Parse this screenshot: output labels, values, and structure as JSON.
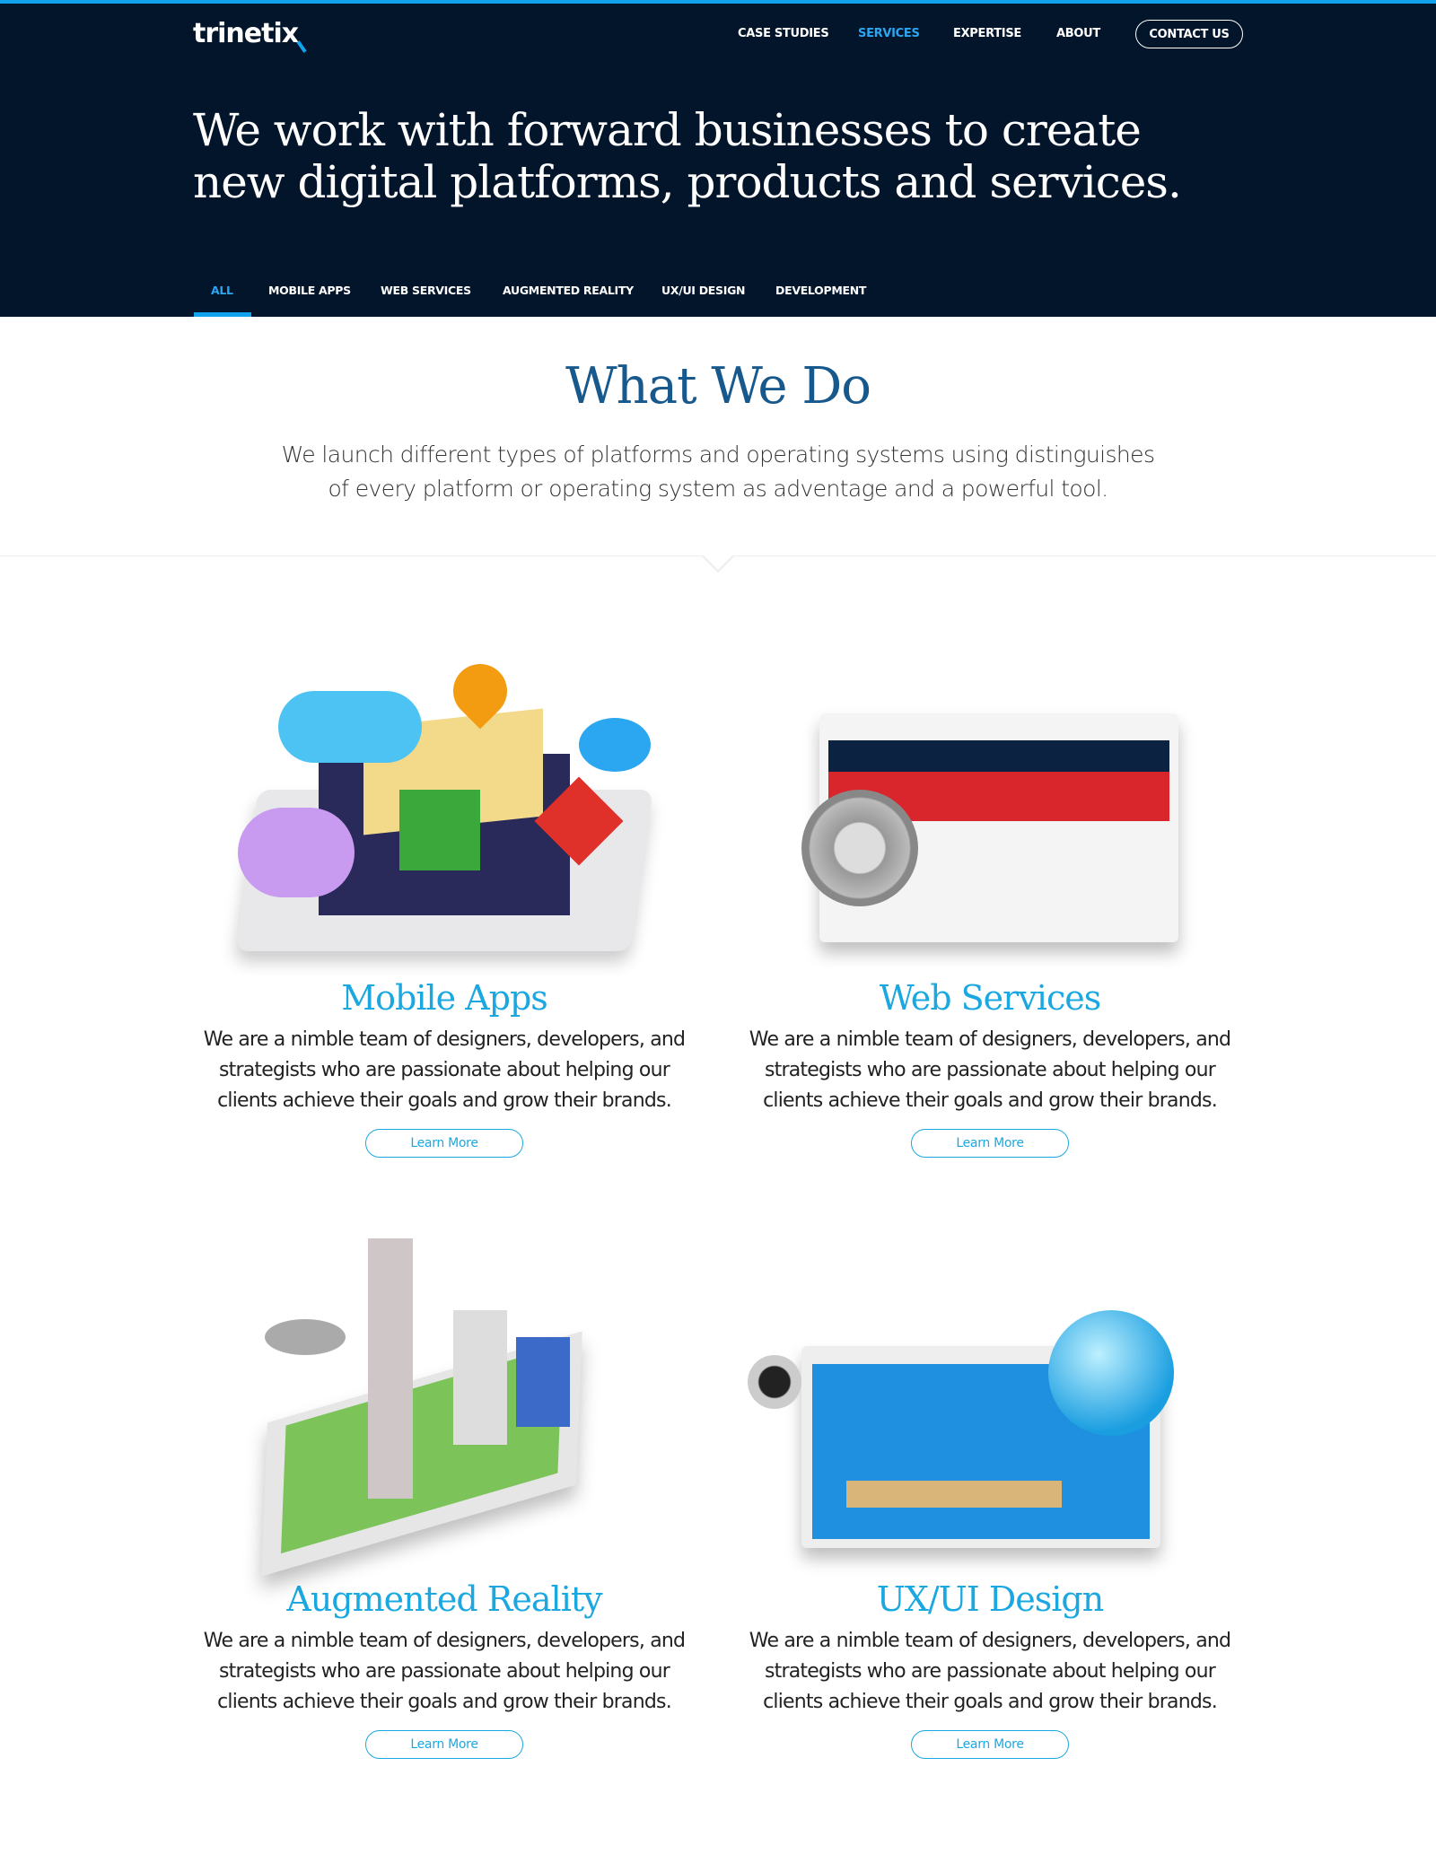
{
  "header": {
    "logo": "trinetix",
    "nav": [
      {
        "label": "CASE STUDIES",
        "active": false
      },
      {
        "label": "SERVICES",
        "active": true
      },
      {
        "label": "EXPERTISE",
        "active": false
      },
      {
        "label": "ABOUT",
        "active": false
      }
    ],
    "contact_label": "CONTACT US"
  },
  "hero": {
    "line1": "We work with forward businesses to create",
    "line2": "new digital platforms, products and services."
  },
  "tabs": [
    {
      "label": "ALL",
      "active": true
    },
    {
      "label": "MOBILE APPS"
    },
    {
      "label": "WEB SERVICES"
    },
    {
      "label": "AUGMENTED REALITY"
    },
    {
      "label": "UX/UI DESIGN"
    },
    {
      "label": "DEVELOPMENT"
    }
  ],
  "section": {
    "title": "What We Do",
    "intro1": "We launch different types of platforms and operating systems using distinguishes",
    "intro2": "of every platform or operating system as adventage and a powerful tool."
  },
  "services": [
    {
      "title": "Mobile Apps",
      "body": "We are a nimble team of designers, developers, and strategists who are passionate about helping our clients achieve their goals and grow their brands.",
      "button": "Learn More"
    },
    {
      "title": "Web Services",
      "body": "We are a nimble team of designers, developers, and strategists who are passionate about helping our clients achieve their goals and grow their brands.",
      "button": "Learn More"
    },
    {
      "title": "Augmented Reality",
      "body": "We are a nimble team of designers, developers, and strategists who are passionate about helping our clients achieve their goals and grow their brands.",
      "button": "Learn More"
    },
    {
      "title": "UX/UI Design",
      "body": "We are a nimble team of designers, developers, and strategists who are passionate about helping our clients achieve their goals and grow their brands.",
      "button": "Learn More"
    }
  ],
  "colors": {
    "hero_bg": "#03152b",
    "accent": "#12a3ee",
    "title": "#17588d",
    "service_title": "#1ba8e0"
  }
}
